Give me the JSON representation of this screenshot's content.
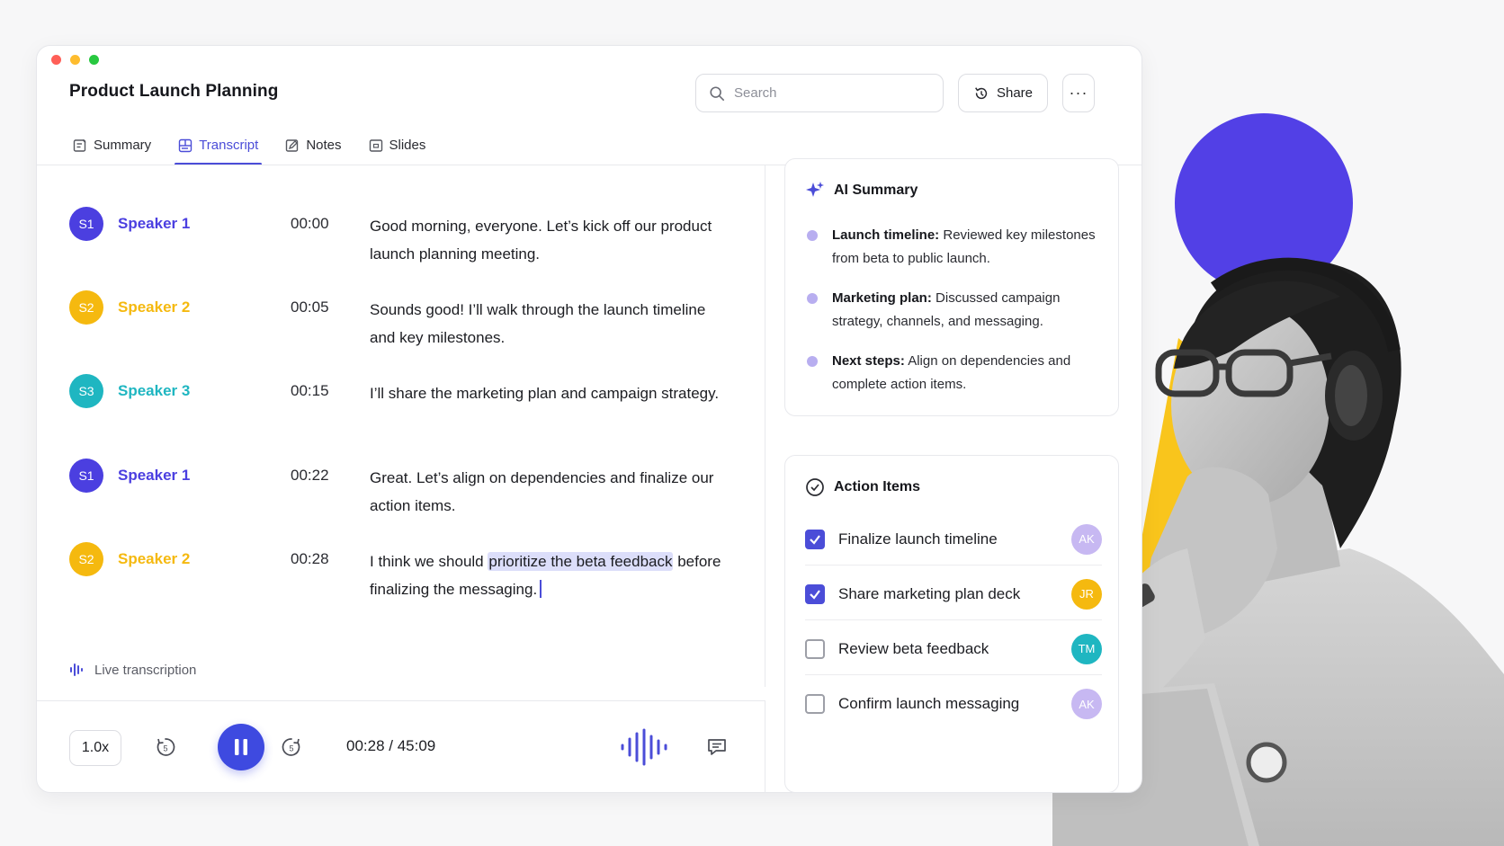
{
  "window": {
    "title": "Product Launch Planning",
    "search_placeholder": "Search",
    "share_label": "Share",
    "more_label": "···"
  },
  "tabs": [
    {
      "label": "Summary",
      "icon": "summary-icon",
      "active": false
    },
    {
      "label": "Transcript",
      "icon": "transcript-icon",
      "active": true
    },
    {
      "label": "Notes",
      "icon": "notes-icon",
      "active": false
    },
    {
      "label": "Slides",
      "icon": "slides-icon",
      "active": false
    }
  ],
  "colors": {
    "accent": "#4b4dd8",
    "speaker1": "#4b3fe0",
    "speaker2": "#f5b90f",
    "speaker3": "#1fb6c1"
  },
  "transcript": [
    {
      "initials": "S1",
      "speaker": "Speaker 1",
      "time": "00:00",
      "text": "Good morning, everyone. Let’s kick off our product launch planning meeting."
    },
    {
      "initials": "S2",
      "speaker": "Speaker 2",
      "time": "00:05",
      "text": "Sounds good! I’ll walk through the launch timeline and key milestones."
    },
    {
      "initials": "S3",
      "speaker": "Speaker 3",
      "time": "00:15",
      "text": "I’ll share the marketing plan and campaign strategy."
    },
    {
      "initials": "S1",
      "speaker": "Speaker 1",
      "time": "00:22",
      "text": "Great. Let’s align on dependencies and finalize our action items."
    },
    {
      "initials": "S2",
      "speaker": "Speaker 2",
      "time": "00:28",
      "text_before": "I think we should ",
      "text_highlight": "prioritize the beta feedback",
      "text_after": " before finalizing the messaging."
    }
  ],
  "live_label": "Live transcription",
  "player": {
    "speed": "1.0x",
    "back_seconds": "5",
    "forward_seconds": "5",
    "time": "00:28 / 45:09"
  },
  "summary": {
    "title": "AI Summary",
    "items": [
      {
        "label": "Launch timeline:",
        "text": " Reviewed key milestones from beta to public launch."
      },
      {
        "label": "Marketing plan:",
        "text": " Discussed campaign strategy, channels, and messaging."
      },
      {
        "label": "Next steps:",
        "text": " Align on dependencies and complete action items."
      }
    ]
  },
  "actions": {
    "title": "Action Items",
    "items": [
      {
        "label": "Finalize launch timeline",
        "checked": true,
        "assignee": "AK",
        "color": "#c7b8f2"
      },
      {
        "label": "Share marketing plan deck",
        "checked": true,
        "assignee": "JR",
        "color": "#f5b90f"
      },
      {
        "label": "Review beta feedback",
        "checked": false,
        "assignee": "TM",
        "color": "#1fb6c1"
      },
      {
        "label": "Confirm launch messaging",
        "checked": false,
        "assignee": "AK",
        "color": "#c7b8f2"
      }
    ]
  }
}
